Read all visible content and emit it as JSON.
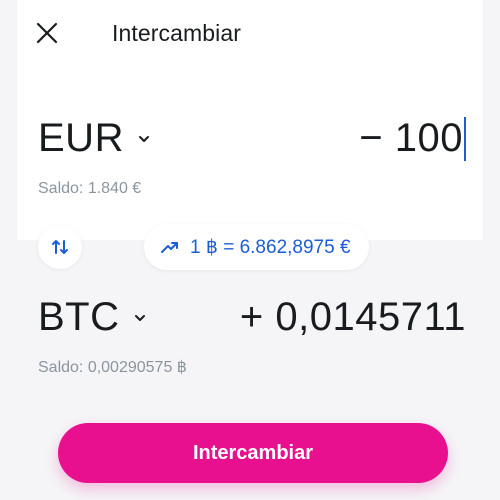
{
  "header": {
    "title": "Intercambiar",
    "close_icon": "close-icon"
  },
  "from": {
    "currency": "EUR",
    "amount": "− 100",
    "balance": "Saldo: 1.840 €"
  },
  "to": {
    "currency": "BTC",
    "amount": "+ 0,0145711",
    "balance": "Saldo: 0,00290575 ฿"
  },
  "rate": {
    "text": "1 ฿ = 6.862,8975 €",
    "icon": "trending-up-icon"
  },
  "swap_icon": "swap-vertical-icon",
  "action": {
    "label": "Intercambiar"
  },
  "colors": {
    "accent": "#e8108e",
    "link": "#1c5dd6",
    "text": "#191c1f",
    "muted": "#8b959e",
    "surface": "#f5f5f7"
  }
}
